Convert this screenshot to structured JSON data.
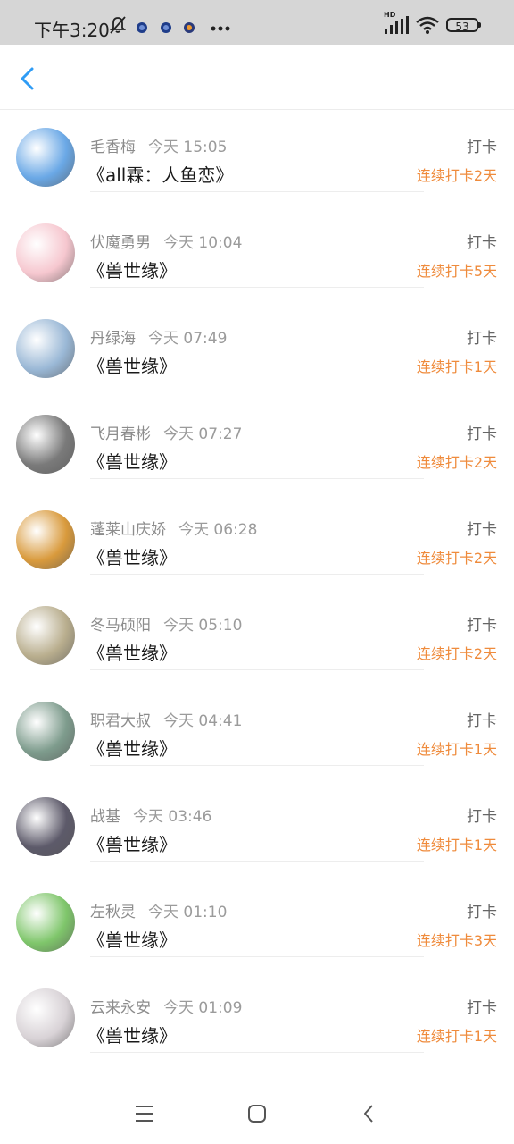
{
  "status_bar": {
    "time": "下午3:20",
    "network": "HD",
    "battery": "53",
    "icons": [
      "mute-bell-icon",
      "app-notification-icon",
      "app-notification-icon",
      "app-notification-icon",
      "more-dots-icon",
      "signal-icon",
      "wifi-icon",
      "battery-icon"
    ]
  },
  "header": {
    "back_icon": "back-arrow-icon"
  },
  "checkins": [
    {
      "name": "毛香梅",
      "time": "今天 15:05",
      "title": "《all霖：人鱼恋》",
      "action": "打卡",
      "streak": "连续打卡2天",
      "avatar_color": "#6aa8e6"
    },
    {
      "name": "伏魔勇男",
      "time": "今天 10:04",
      "title": "《兽世缘》",
      "action": "打卡",
      "streak": "连续打卡5天",
      "avatar_color": "#f6c7cf"
    },
    {
      "name": "丹绿海",
      "time": "今天 07:49",
      "title": "《兽世缘》",
      "action": "打卡",
      "streak": "连续打卡1天",
      "avatar_color": "#9ab8d6"
    },
    {
      "name": "飞月春彬",
      "time": "今天 07:27",
      "title": "《兽世缘》",
      "action": "打卡",
      "streak": "连续打卡2天",
      "avatar_color": "#7a7a7a"
    },
    {
      "name": "蓬莱山庆娇",
      "time": "今天 06:28",
      "title": "《兽世缘》",
      "action": "打卡",
      "streak": "连续打卡2天",
      "avatar_color": "#d99a3c"
    },
    {
      "name": "冬马硕阳",
      "time": "今天 05:10",
      "title": "《兽世缘》",
      "action": "打卡",
      "streak": "连续打卡2天",
      "avatar_color": "#b9ae8e"
    },
    {
      "name": "职君大叔",
      "time": "今天 04:41",
      "title": "《兽世缘》",
      "action": "打卡",
      "streak": "连续打卡1天",
      "avatar_color": "#7e9c8d"
    },
    {
      "name": "战基",
      "time": "今天 03:46",
      "title": "《兽世缘》",
      "action": "打卡",
      "streak": "连续打卡1天",
      "avatar_color": "#5d5a6a"
    },
    {
      "name": "左秋灵",
      "time": "今天 01:10",
      "title": "《兽世缘》",
      "action": "打卡",
      "streak": "连续打卡3天",
      "avatar_color": "#7fc66b"
    },
    {
      "name": "云来永安",
      "time": "今天 01:09",
      "title": "《兽世缘》",
      "action": "打卡",
      "streak": "连续打卡1天",
      "avatar_color": "#d8d2d6"
    }
  ],
  "bottom_nav": {
    "items": [
      "menu-icon",
      "home-icon",
      "back-icon"
    ]
  },
  "colors": {
    "accent_blue": "#2f9cf5",
    "streak_orange": "#ef8b3c",
    "name_gray": "#8c8c8c"
  }
}
